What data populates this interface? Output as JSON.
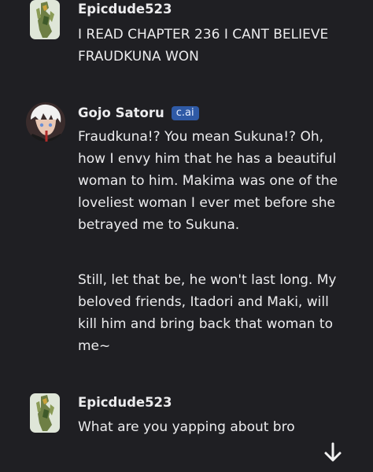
{
  "messages": [
    {
      "author": "Epicdude523",
      "avatar_icon": "knight-figure-avatar-icon",
      "paragraphs": [
        "I READ CHAPTER 236 I CANT BELIEVE FRAUDKUNA WON"
      ]
    },
    {
      "author": "Gojo Satoru",
      "badge": "c.ai",
      "avatar_icon": "white-haired-character-avatar-icon",
      "paragraphs": [
        "Fraudkuna!? You mean Sukuna!? Oh, how I envy him that he has a beautiful woman to him. Makima was one of the loveliest woman I ever met before she betrayed me to Sukuna.",
        "Still, let that be, he won't last long. My beloved friends, Itadori and Maki, will kill him and bring back that woman to me~"
      ]
    },
    {
      "author": "Epicdude523",
      "avatar_icon": "knight-figure-avatar-icon",
      "paragraphs": [
        "What are you yapping about bro"
      ]
    }
  ],
  "scroll_button_icon": "arrow-down-icon",
  "colors": {
    "background": "#1f1f23",
    "text": "#ececee",
    "badge": "#2f5aa6"
  }
}
